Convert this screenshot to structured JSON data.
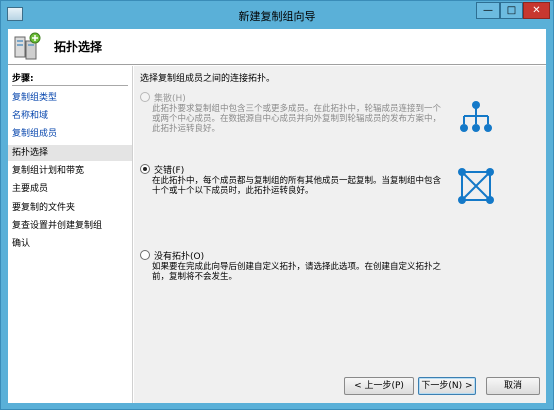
{
  "window": {
    "title": "新建复制组向导",
    "controls": {
      "minimize": "—",
      "maximize": "□",
      "close": "✕"
    }
  },
  "header": {
    "title": "拓扑选择",
    "icon": "replication-server-icon"
  },
  "sidebar": {
    "steps_label": "步骤:",
    "steps": [
      {
        "label": "复制组类型",
        "state": "link"
      },
      {
        "label": "名称和域",
        "state": "link"
      },
      {
        "label": "复制组成员",
        "state": "link"
      },
      {
        "label": "拓扑选择",
        "state": "current"
      },
      {
        "label": "复制组计划和带宽",
        "state": "normal"
      },
      {
        "label": "主要成员",
        "state": "normal"
      },
      {
        "label": "要复制的文件夹",
        "state": "normal"
      },
      {
        "label": "复查设置并创建复制组",
        "state": "normal"
      },
      {
        "label": "确认",
        "state": "normal"
      }
    ]
  },
  "main": {
    "instruction": "选择复制组成员之间的连接拓扑。",
    "options": [
      {
        "label": "集散(H)",
        "description": "此拓扑要求复制组中包含三个或更多成员。在此拓扑中，轮辐成员连接到一个或两个中心成员。在数据源自中心成员并向外复制到轮辐成员的发布方案中，此拓扑运转良好。",
        "checked": false,
        "disabled": true,
        "icon": "hub-and-spoke-icon"
      },
      {
        "label": "交错(F)",
        "description": "在此拓扑中，每个成员都与复制组的所有其他成员一起复制。当复制组中包含十个或十个以下成员时，此拓扑运转良好。",
        "checked": true,
        "disabled": false,
        "icon": "full-mesh-icon"
      },
      {
        "label": "没有拓扑(O)",
        "description": "如果要在完成此向导后创建自定义拓扑，请选择此选项。在创建自定义拓扑之前，复制将不会发生。",
        "checked": false,
        "disabled": false,
        "icon": ""
      }
    ]
  },
  "buttons": {
    "back": "< 上一步(P)",
    "next": "下一步(N) >",
    "cancel": "取消"
  },
  "colors": {
    "titlebar": "#5ab0d8",
    "link": "#0645ad",
    "icon_blue": "#1479c8",
    "close": "#c7372f"
  }
}
